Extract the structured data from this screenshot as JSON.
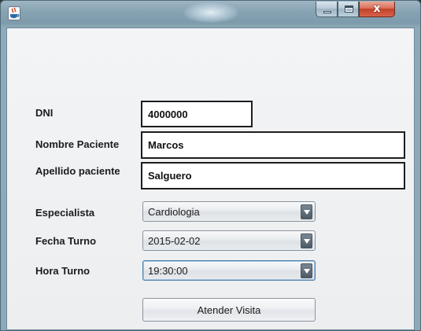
{
  "window": {
    "icon": "java-cup-icon",
    "controls": {
      "minimize": "minimize-icon",
      "maximize": "maximize-icon",
      "close": "close-icon"
    },
    "close_glyph": "x"
  },
  "form": {
    "dni": {
      "label": "DNI",
      "value": "4000000"
    },
    "nombre": {
      "label": "Nombre Paciente",
      "value": "Marcos"
    },
    "apellido": {
      "label": "Apellido paciente",
      "value": "Salguero"
    },
    "especialista": {
      "label": "Especialista",
      "selected": "Cardiologia"
    },
    "fecha": {
      "label": "Fecha Turno",
      "selected": "2015-02-02"
    },
    "hora": {
      "label": "Hora Turno",
      "selected": "19:30:00"
    },
    "submit_label": "Atender Visita"
  }
}
